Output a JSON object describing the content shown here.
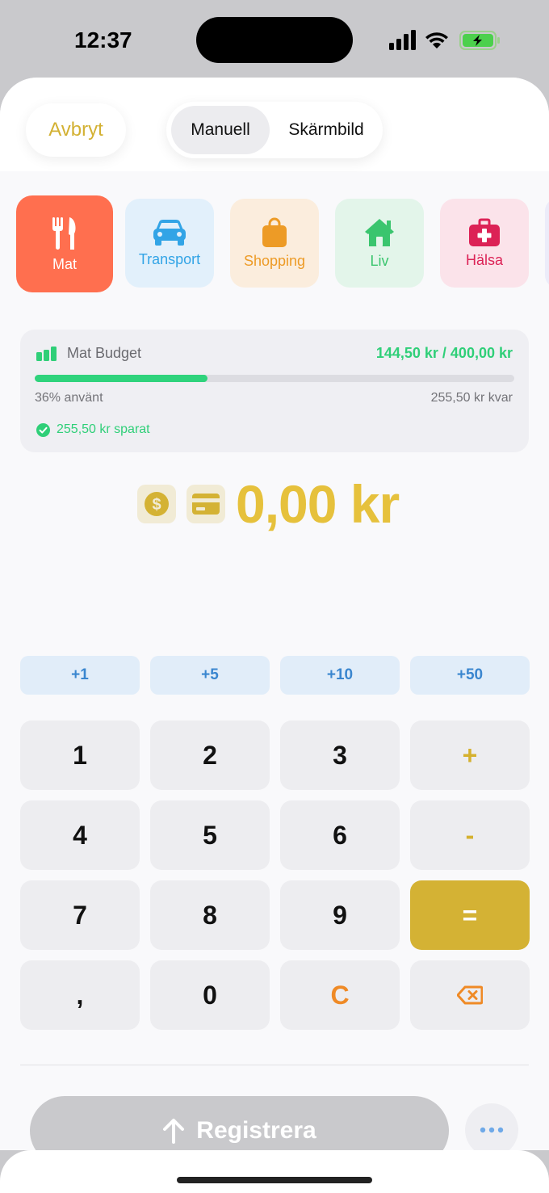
{
  "status_bar": {
    "time": "12:37",
    "icons": [
      "cellular-icon",
      "wifi-icon",
      "battery-charging-icon"
    ]
  },
  "header": {
    "cancel_label": "Avbryt",
    "tabs": [
      {
        "label": "Manuell",
        "selected": true
      },
      {
        "label": "Skärmbild",
        "selected": false
      }
    ]
  },
  "categories": [
    {
      "label": "Mat",
      "icon": "fork-knife-icon",
      "color": "#ff6f4f",
      "selected": true
    },
    {
      "label": "Transport",
      "icon": "car-icon",
      "color": "#32a4e6",
      "selected": false
    },
    {
      "label": "Shopping",
      "icon": "shopping-bag-icon",
      "color": "#ed9b26",
      "selected": false
    },
    {
      "label": "Liv",
      "icon": "house-icon",
      "color": "#3ac56e",
      "selected": false
    },
    {
      "label": "Hälsa",
      "icon": "medical-kit-icon",
      "color": "#dc2256",
      "selected": false
    }
  ],
  "budget": {
    "title": "Mat Budget",
    "amount_text": "144,50 kr / 400,00 kr",
    "progress_fraction": 0.36,
    "used_text": "36% använt",
    "left_text": "255,50 kr kvar",
    "saved_text": "255,50 kr sparat",
    "accent_color": "#2fcf78"
  },
  "entry": {
    "amount": "0,00 kr",
    "icons": [
      "dollar-coin-icon",
      "credit-card-icon"
    ],
    "accent_color": "#e6c13c"
  },
  "quick_add": [
    "+1",
    "+5",
    "+10",
    "+50"
  ],
  "keypad": {
    "keys": [
      [
        "1",
        "2",
        "3",
        "+"
      ],
      [
        "4",
        "5",
        "6",
        "-"
      ],
      [
        "7",
        "8",
        "9",
        "="
      ],
      [
        ",",
        "0",
        "C",
        ""
      ]
    ]
  },
  "footer": {
    "register_label": "Registrera",
    "more_icon": "ellipsis-icon"
  }
}
